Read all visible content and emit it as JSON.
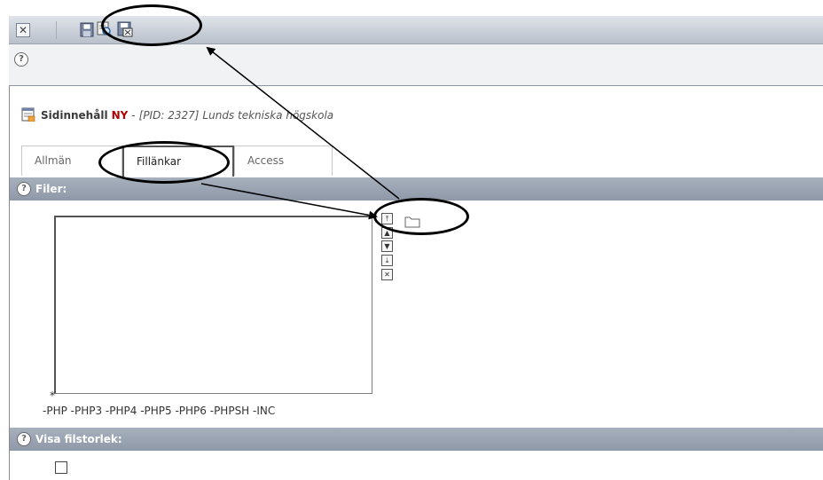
{
  "toolbar": {
    "close_glyph": "✕",
    "buttons": [
      "save-icon",
      "save-and-view-icon",
      "save-and-close-icon"
    ]
  },
  "help": {
    "glyph": "?"
  },
  "record": {
    "table_name": "Sidinnehåll",
    "status": "NY",
    "separator": "-",
    "pid": "[PID: 2327]",
    "page_title": "Lunds tekniska högskola"
  },
  "tabs": [
    {
      "label": "Allmän"
    },
    {
      "label": "Fillänkar"
    },
    {
      "label": "Access"
    }
  ],
  "sections": {
    "files_label": "Filer:",
    "show_size_label": "Visa filstorlek:"
  },
  "files": {
    "allowed_marker": "*",
    "disallowed": "-PHP -PHP3 -PHP4 -PHP5 -PHP6 -PHPSH -INC"
  },
  "list_controls": [
    "move-to-top-icon",
    "move-up-icon",
    "move-down-icon",
    "move-to-bottom-icon",
    "remove-selected-icon"
  ],
  "colors": {
    "status_red": "#b30000",
    "section_bar": "#9aa3b1",
    "annotation": "#000000"
  }
}
